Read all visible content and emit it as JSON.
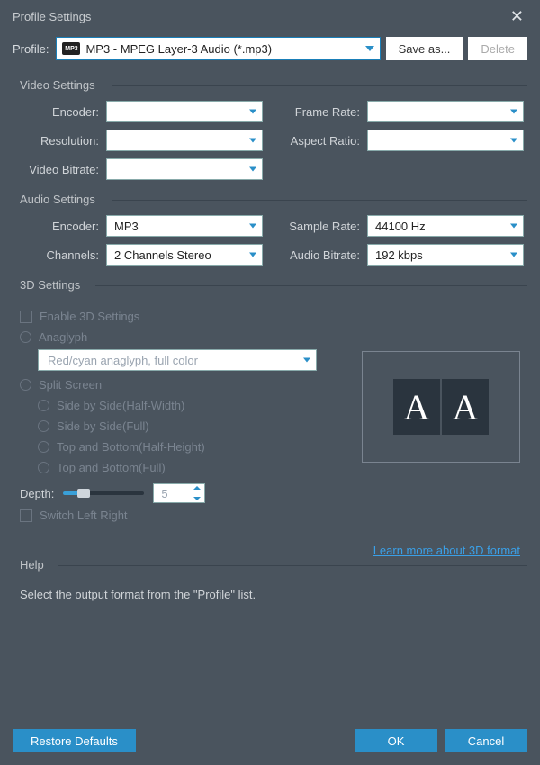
{
  "window": {
    "title": "Profile Settings"
  },
  "profile": {
    "label": "Profile:",
    "badge": "MP3",
    "value": "MP3 - MPEG Layer-3 Audio (*.mp3)",
    "save_as": "Save as...",
    "delete": "Delete"
  },
  "video": {
    "section": "Video Settings",
    "encoder_label": "Encoder:",
    "encoder": "",
    "framerate_label": "Frame Rate:",
    "framerate": "",
    "resolution_label": "Resolution:",
    "resolution": "",
    "aspect_label": "Aspect Ratio:",
    "aspect": "",
    "bitrate_label": "Video Bitrate:",
    "bitrate": ""
  },
  "audio": {
    "section": "Audio Settings",
    "encoder_label": "Encoder:",
    "encoder": "MP3",
    "samplerate_label": "Sample Rate:",
    "samplerate": "44100 Hz",
    "channels_label": "Channels:",
    "channels": "2 Channels Stereo",
    "bitrate_label": "Audio Bitrate:",
    "bitrate": "192 kbps"
  },
  "threeD": {
    "section": "3D Settings",
    "enable": "Enable 3D Settings",
    "anaglyph": "Anaglyph",
    "anaglyph_value": "Red/cyan anaglyph, full color",
    "split": "Split Screen",
    "sbs_half": "Side by Side(Half-Width)",
    "sbs_full": "Side by Side(Full)",
    "tab_half": "Top and Bottom(Half-Height)",
    "tab_full": "Top and Bottom(Full)",
    "depth_label": "Depth:",
    "depth_value": "5",
    "switch_lr": "Switch Left Right",
    "learn_more": "Learn more about 3D format",
    "preview_glyph": "A"
  },
  "help": {
    "section": "Help",
    "text": "Select the output format from the \"Profile\" list."
  },
  "footer": {
    "restore": "Restore Defaults",
    "ok": "OK",
    "cancel": "Cancel"
  }
}
